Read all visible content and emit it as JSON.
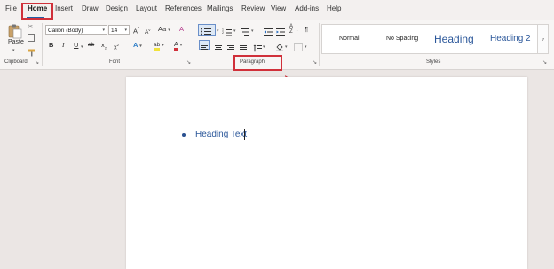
{
  "tabs": [
    "File",
    "Home",
    "Insert",
    "Draw",
    "Design",
    "Layout",
    "References",
    "Mailings",
    "Review",
    "View",
    "Add-ins",
    "Help"
  ],
  "clipboard": {
    "paste_label": "Paste",
    "group_label": "Clipboard"
  },
  "font": {
    "name": "Calibri (Body)",
    "size": "14",
    "group_label": "Font",
    "grow_label": "A",
    "shrink_label": "A",
    "case_label": "Aa",
    "bold": "B",
    "italic": "I",
    "underline": "U",
    "strike": "ab",
    "sub": "x",
    "sup": "x",
    "effects": "A",
    "highlight": "ab",
    "color": "A"
  },
  "paragraph": {
    "group_label": "Paragraph",
    "pilcrow": "¶"
  },
  "styles": {
    "group_label": "Styles",
    "items": [
      "Normal",
      "No Spacing",
      "Heading",
      "Heading 2"
    ]
  },
  "document": {
    "text": "Heading Text"
  },
  "colors": {
    "accent": "#2b579a",
    "highlight_box": "#d0303a"
  }
}
